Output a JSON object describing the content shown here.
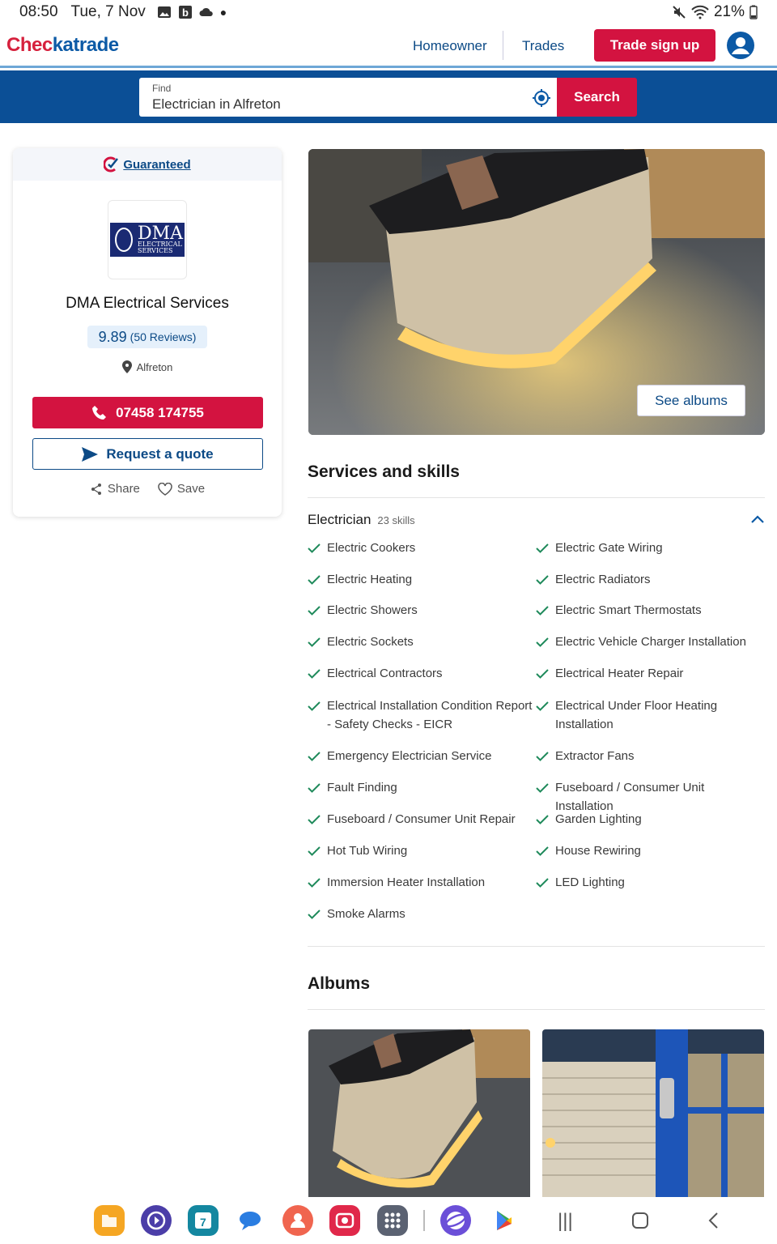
{
  "status_bar": {
    "time": "08:50",
    "date": "Tue, 7 Nov",
    "battery": "21%"
  },
  "header": {
    "logo_part1": "Chec",
    "logo_part2": "katrade",
    "nav_homeowner": "Homeowner",
    "nav_trades": "Trades",
    "trade_signup": "Trade sign up"
  },
  "search": {
    "label": "Find",
    "value": "Electrician in Alfreton",
    "button": "Search"
  },
  "profile": {
    "guaranteed": "Guaranteed",
    "logo_big": "DMA",
    "logo_small_1": "ELECTRICAL",
    "logo_small_2": "SERVICES",
    "name": "DMA Electrical Services",
    "score": "9.89",
    "reviews": "(50 Reviews)",
    "location": "Alfreton",
    "phone": "07458 174755",
    "quote": "Request a quote",
    "share": "Share",
    "save": "Save"
  },
  "hero": {
    "see_albums": "See albums"
  },
  "services": {
    "title": "Services and skills",
    "category": "Electrician",
    "count": "23 skills",
    "skills": [
      "Electric Cookers",
      "Electric Gate Wiring",
      "Electric Heating",
      "Electric Radiators",
      "Electric Showers",
      "Electric Smart Thermostats",
      "Electric Sockets",
      "Electric Vehicle Charger Installation",
      "Electrical Contractors",
      "Electrical Heater Repair",
      "Electrical Installation Condition Report - Safety Checks - EICR",
      "Electrical Under Floor Heating Installation",
      "Emergency Electrician Service",
      "Extractor Fans",
      "Fault Finding",
      "Fuseboard / Consumer Unit Installation",
      "Fuseboard / Consumer Unit Repair",
      "Garden Lighting",
      "Hot Tub Wiring",
      "House Rewiring",
      "Immersion Heater Installation",
      "LED Lighting",
      "Smoke Alarms"
    ]
  },
  "albums": {
    "title": "Albums"
  },
  "colors": {
    "brand_red": "#d31340",
    "brand_blue": "#0b4f96",
    "link_blue": "#0c4a86",
    "tick_green": "#1f8a5b"
  }
}
